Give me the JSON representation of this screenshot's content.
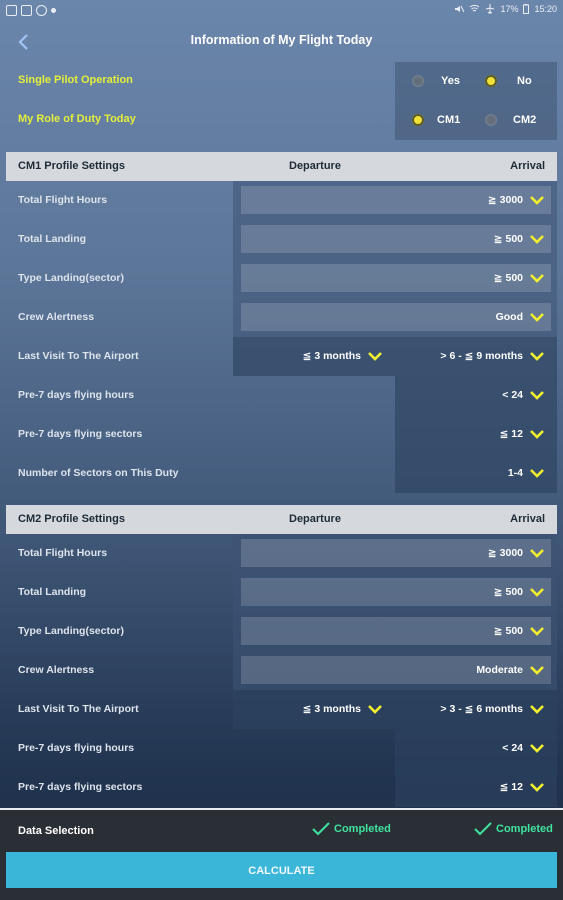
{
  "status": {
    "battery": "17%",
    "time": "15:20"
  },
  "title": "Information of My Flight Today",
  "top": {
    "single_pilot": {
      "label": "Single Pilot Operation",
      "opt1": "Yes",
      "opt2": "No",
      "selected": "No"
    },
    "role": {
      "label": "My Role of Duty Today",
      "opt1": "CM1",
      "opt2": "CM2",
      "selected": "CM1"
    }
  },
  "cm1": {
    "header": {
      "title": "CM1 Profile Settings",
      "departure": "Departure",
      "arrival": "Arrival"
    },
    "rows": [
      {
        "label": "Total Flight Hours",
        "value": "≧ 3000"
      },
      {
        "label": "Total Landing",
        "value": "≧ 500"
      },
      {
        "label": "Type Landing(sector)",
        "value": "≧ 500"
      },
      {
        "label": "Crew Alertness",
        "value": "Good"
      },
      {
        "label": "Last Visit To The Airport",
        "dep": "≦ 3 months",
        "arr": "> 6 - ≦ 9 months"
      },
      {
        "label": "Pre-7 days flying hours",
        "arr": "< 24"
      },
      {
        "label": "Pre-7 days flying sectors",
        "arr": "≦ 12"
      },
      {
        "label": "Number of Sectors on This Duty",
        "arr": "1-4"
      }
    ]
  },
  "cm2": {
    "header": {
      "title": "CM2 Profile Settings",
      "departure": "Departure",
      "arrival": "Arrival"
    },
    "rows": [
      {
        "label": "Total Flight Hours",
        "value": "≧ 3000"
      },
      {
        "label": "Total Landing",
        "value": "≧ 500"
      },
      {
        "label": "Type Landing(sector)",
        "value": "≧ 500"
      },
      {
        "label": "Crew Alertness",
        "value": "Moderate"
      },
      {
        "label": "Last Visit To The Airport",
        "dep": "≦ 3 months",
        "arr": "> 3 - ≦ 6 months"
      },
      {
        "label": "Pre-7 days flying hours",
        "arr": "< 24"
      },
      {
        "label": "Pre-7 days flying sectors",
        "arr": "≦ 12"
      }
    ]
  },
  "footer": {
    "label": "Data Selection",
    "dep_status": "Completed",
    "arr_status": "Completed",
    "button": "CALCULATE"
  },
  "colors": {
    "accent_yellow": "#e4ef3a",
    "chevron": "#f2ef2e",
    "completed": "#3fe3a0",
    "button": "#3ab6d8"
  }
}
